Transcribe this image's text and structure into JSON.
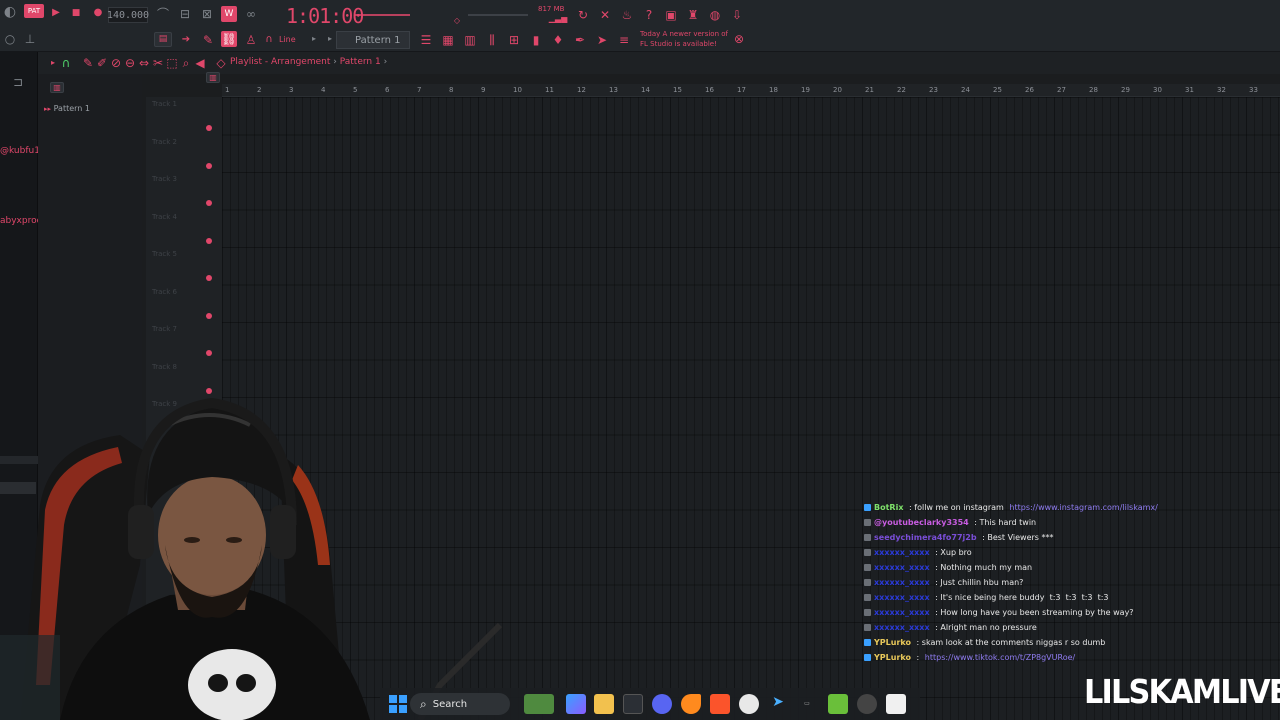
{
  "toolbar": {
    "tempo": "140.000",
    "time": "1:01:00",
    "memory": "817 MB",
    "snap": "Line",
    "pattern": "Pattern 1",
    "news": [
      "Today A newer version of",
      "FL Studio is available!"
    ]
  },
  "overlay": {
    "handle1": "@kubfu1]",
    "handle2": "abyxprod"
  },
  "browser": {
    "pattern_item": "Pattern 1"
  },
  "playlist": {
    "title": "Playlist - Arrangement",
    "pattern": "Pattern 1",
    "tracks": [
      "Track 1",
      "Track 2",
      "Track 3",
      "Track 4",
      "Track 5",
      "Track 6",
      "Track 7",
      "Track 8",
      "Track 9"
    ],
    "ruler": [
      "1",
      "2",
      "3",
      "4",
      "5",
      "6",
      "7",
      "8",
      "9",
      "10",
      "11",
      "12",
      "13",
      "14",
      "15",
      "16",
      "17",
      "18",
      "19",
      "20",
      "21",
      "22",
      "23",
      "24",
      "25",
      "26",
      "27",
      "28",
      "29",
      "30",
      "31",
      "32",
      "33"
    ]
  },
  "chat": [
    {
      "name": "BotRix",
      "msg": " : follw me on instagram ",
      "link": "https://www.instagram.com/lilskamx/",
      "color": "#7ee06a"
    },
    {
      "name": "@youtubeclarky3354",
      "msg": " : This hard twin",
      "link": "",
      "color": "#c75ce0"
    },
    {
      "name": "seedychimera4fo77j2b",
      "msg": " : Best Viewers ***",
      "link": "",
      "color": "#7a4ed8"
    },
    {
      "name": "xxxxxx_xxxx",
      "msg": " : Xup bro",
      "link": "",
      "color": "#2a3ad8"
    },
    {
      "name": "xxxxxx_xxxx",
      "msg": " : Nothing much my man",
      "link": "",
      "color": "#2a3ad8"
    },
    {
      "name": "xxxxxx_xxxx",
      "msg": " : Just chillin hbu man?",
      "link": "",
      "color": "#2a3ad8"
    },
    {
      "name": "xxxxxx_xxxx",
      "msg": " : It's nice being here buddy  t:3  t:3  t:3  t:3",
      "link": "",
      "color": "#2a3ad8"
    },
    {
      "name": "xxxxxx_xxxx",
      "msg": " : How long have you been streaming by the way?",
      "link": "",
      "color": "#2a3ad8"
    },
    {
      "name": "xxxxxx_xxxx",
      "msg": " : Alright man no pressure",
      "link": "",
      "color": "#2a3ad8"
    },
    {
      "name": "YPLurko",
      "msg": " : skam look at the comments niggas r so dumb",
      "link": "",
      "color": "#e8c85a"
    },
    {
      "name": "YPLurko",
      "msg": " : ",
      "link": "https://www.tiktok.com/t/ZP8gVURoe/",
      "color": "#e8c85a"
    }
  ],
  "taskbar": {
    "search": "Search"
  },
  "brand": "LILSKAMLIVE"
}
